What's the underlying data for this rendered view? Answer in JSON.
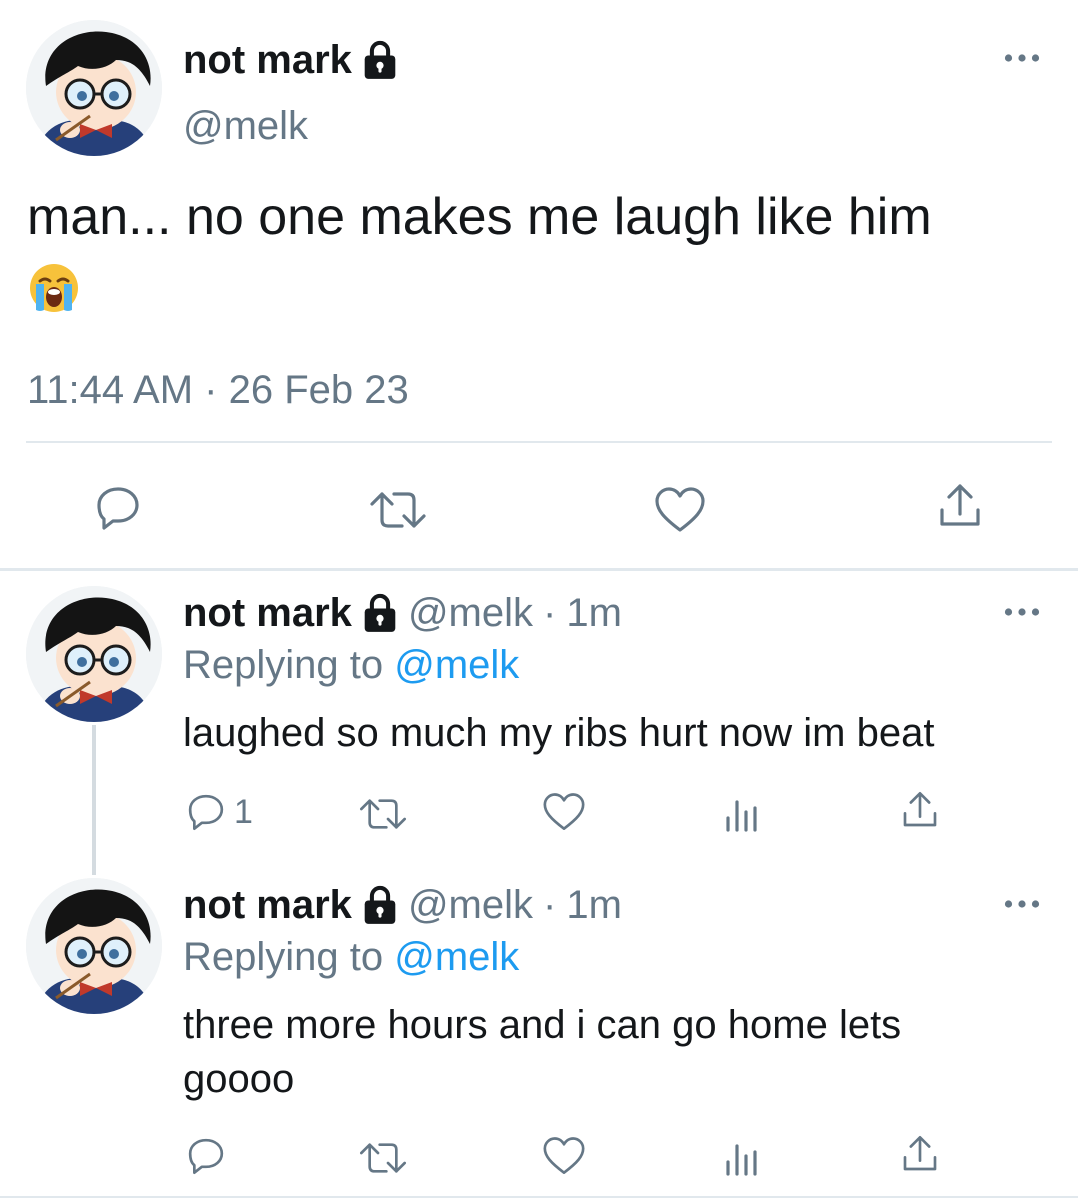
{
  "main_tweet": {
    "display_name": "not mark",
    "handle": "@melk",
    "text": "man... no one makes me laugh like him",
    "emoji": "loudly-crying-face",
    "timestamp": "11:44 AM · 26 Feb 23",
    "actions": [
      "reply-icon",
      "retweet-icon",
      "like-icon",
      "share-icon"
    ]
  },
  "replies": [
    {
      "display_name": "not mark",
      "handle": "@melk",
      "separator": "·",
      "age": "1m",
      "replying_prefix": "Replying to",
      "replying_handle": "@melk",
      "text": "laughed so much my ribs hurt now im beat",
      "reply_count": "1"
    },
    {
      "display_name": "not mark",
      "handle": "@melk",
      "separator": "·",
      "age": "1m",
      "replying_prefix": "Replying to",
      "replying_handle": "@melk",
      "text": "three more hours and i can go home lets goooo",
      "reply_count": ""
    }
  ],
  "colors": {
    "text": "#14171a",
    "muted": "#657786",
    "link": "#1d9bf0",
    "divider": "#e1e8ed"
  }
}
